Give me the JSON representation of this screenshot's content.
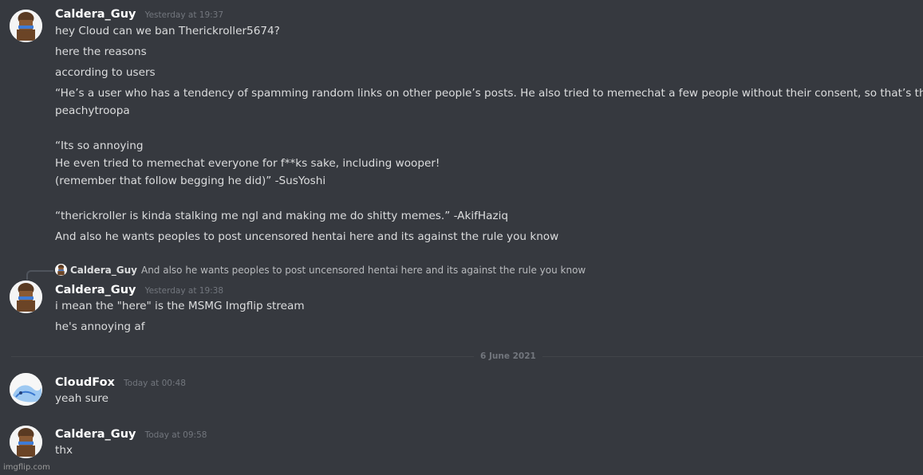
{
  "messages": [
    {
      "author": "Caldera_Guy",
      "timestamp": "Yesterday at 19:37",
      "lines": [
        "hey Cloud can we ban Therickroller5674?",
        "here the reasons",
        "according to users",
        "“He’s a user who has a tendency of spamming random links on other people’s posts. He also tried to memechat a few people without their consent, so that’s that” -",
        "peachytroopa",
        "“Its so annoying",
        "He even tried to memechat everyone for f**ks sake, including wooper!",
        "(remember that follow begging he did)” -SusYoshi",
        "“therickroller is kinda stalking me ngl and making me do shitty memes.” -AkifHaziq",
        "And also he wants peoples to post uncensored hentai here and its against the rule you know"
      ]
    },
    {
      "reply_to": {
        "author": "Caldera_Guy",
        "text": "And also he wants peoples to post uncensored hentai here and its against the rule you know"
      },
      "author": "Caldera_Guy",
      "timestamp": "Yesterday at 19:38",
      "lines": [
        "i mean the \"here\" is the MSMG Imgflip stream",
        "he's annoying af"
      ]
    },
    {
      "author": "CloudFox",
      "timestamp": "Today at 00:48",
      "lines": [
        "yeah sure"
      ]
    },
    {
      "author": "Caldera_Guy",
      "timestamp": "Today at 09:58",
      "lines": [
        "thx"
      ]
    }
  ],
  "date_divider": "6 June 2021",
  "watermark": "imgflip.com",
  "colors": {
    "background": "#36393f",
    "username": "#ffffff",
    "text": "#dcddde",
    "timestamp": "#72767d"
  },
  "icons": {
    "caldera_avatar": "caldera-guy-avatar-icon",
    "cloudfox_avatar": "cloudfox-avatar-icon"
  }
}
